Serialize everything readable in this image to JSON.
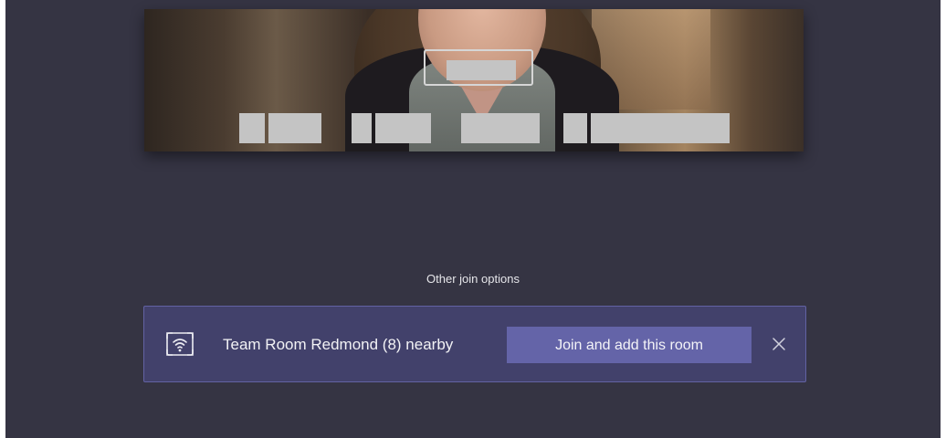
{
  "join_options": {
    "label": "Other join options"
  },
  "nearby_room": {
    "name": "Team Room Redmond (8) nearby",
    "join_button_label": "Join and add this room",
    "icon": "room-wifi-icon",
    "close_icon": "close-icon"
  },
  "colors": {
    "background": "#353443",
    "banner": "#42416b",
    "banner_border": "#6262a3",
    "button": "#6464a8",
    "text": "#f2f2f5"
  }
}
